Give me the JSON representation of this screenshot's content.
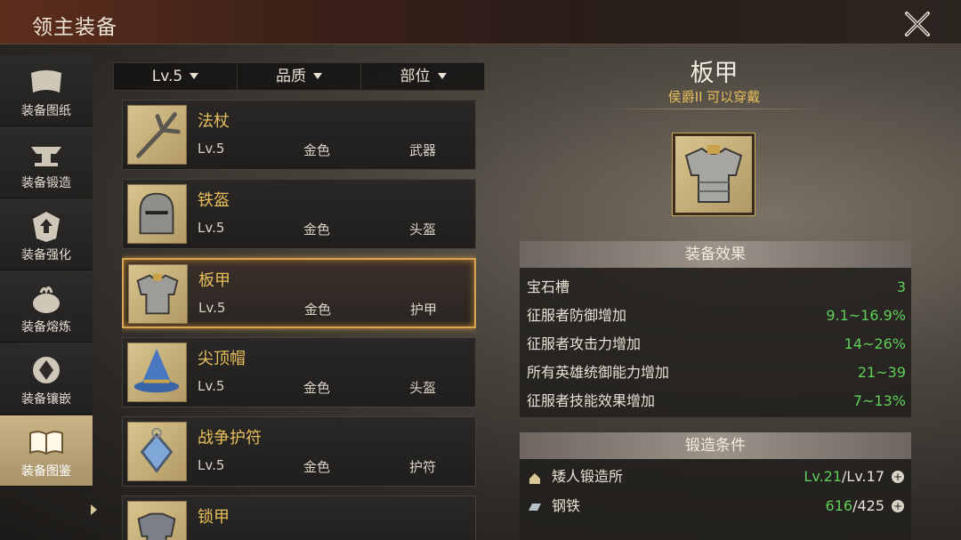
{
  "window": {
    "title": "领主装备"
  },
  "sidebar": {
    "items": [
      {
        "label": "装备图纸",
        "icon": "scroll-icon"
      },
      {
        "label": "装备锻造",
        "icon": "anvil-icon"
      },
      {
        "label": "装备强化",
        "icon": "armor-upgrade-icon"
      },
      {
        "label": "装备熔炼",
        "icon": "cauldron-icon"
      },
      {
        "label": "装备镶嵌",
        "icon": "gem-socket-icon"
      },
      {
        "label": "装备图鉴",
        "icon": "book-icon"
      }
    ],
    "active_index": 5
  },
  "filters": [
    {
      "label": "Lv.5"
    },
    {
      "label": "品质"
    },
    {
      "label": "部位"
    }
  ],
  "list": [
    {
      "name": "法杖",
      "level": "Lv.5",
      "quality": "金色",
      "slot": "武器"
    },
    {
      "name": "铁盔",
      "level": "Lv.5",
      "quality": "金色",
      "slot": "头盔"
    },
    {
      "name": "板甲",
      "level": "Lv.5",
      "quality": "金色",
      "slot": "护甲"
    },
    {
      "name": "尖顶帽",
      "level": "Lv.5",
      "quality": "金色",
      "slot": "头盔"
    },
    {
      "name": "战争护符",
      "level": "Lv.5",
      "quality": "金色",
      "slot": "护符"
    },
    {
      "name": "锁甲",
      "level": "",
      "quality": "",
      "slot": ""
    }
  ],
  "selected_index": 2,
  "detail": {
    "name": "板甲",
    "requirement": "侯爵II 可以穿戴",
    "effects_title": "装备效果",
    "effects": [
      {
        "label": "宝石槽",
        "value": "3"
      },
      {
        "label": "征服者防御增加",
        "value": "9.1~16.9%"
      },
      {
        "label": "征服者攻击力增加",
        "value": "14~26%"
      },
      {
        "label": "所有英雄统御能力增加",
        "value": "21~39"
      },
      {
        "label": "征服者技能效果增加",
        "value": "7~13%"
      }
    ],
    "forge_title": "锻造条件",
    "forge": [
      {
        "label": "矮人锻造所",
        "have": "Lv.21",
        "need": "/Lv.17",
        "icon": "forge-building-icon"
      },
      {
        "label": "钢铁",
        "have": "616",
        "need": "/425",
        "icon": "iron-ingot-icon"
      }
    ]
  },
  "colors": {
    "gold_text": "#e8bf5c",
    "green_value": "#5fcf5a",
    "selected_border": "#d8a653"
  }
}
